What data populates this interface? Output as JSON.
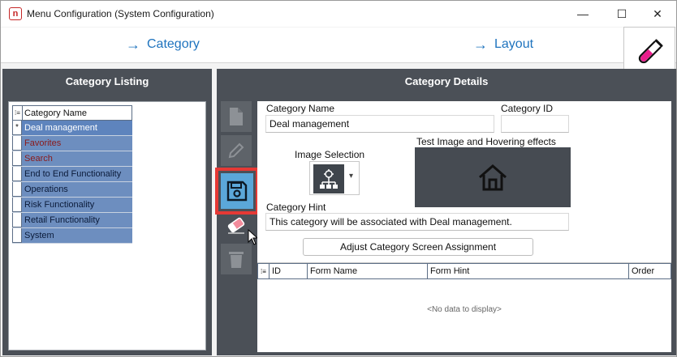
{
  "window": {
    "title": "Menu Configuration (System Configuration)",
    "controls": {
      "minimize": "—",
      "maximize": "☐",
      "close": "✕"
    }
  },
  "nav": {
    "category_label": "Category",
    "layout_label": "Layout",
    "arrow": "→"
  },
  "left_panel": {
    "title": "Category Listing",
    "grid_header": "Category Name",
    "indicator_symbol": "*",
    "header_icon": "⁞≡",
    "items": [
      "Deal management",
      "Favorites",
      "Search",
      "End to End Functionality",
      "Operations",
      "Risk Functionality",
      "Retail Functionality",
      "System"
    ]
  },
  "right_panel": {
    "title": "Category Details",
    "labels": {
      "category_name": "Category Name",
      "category_id": "Category ID",
      "image_selection": "Image Selection",
      "test_image": "Test Image and Hovering effects",
      "category_hint": "Category Hint"
    },
    "values": {
      "category_name": "Deal management",
      "category_id": "",
      "category_hint": "This category will be associated with Deal management."
    },
    "adjust_button": "Adjust Category Screen Assignment",
    "form_grid": {
      "header_icon": "⁞≡",
      "columns": [
        "ID",
        "Form Name",
        "Form Hint",
        "Order"
      ],
      "empty_text": "<No data to display>"
    }
  },
  "colors": {
    "panel_bg": "#4b5057",
    "row_selected": "#6d8ebf",
    "link_blue": "#1e73be",
    "highlight_red": "#e53935",
    "save_blue": "#5ba7d9",
    "flask_pink": "#e91e8c"
  }
}
